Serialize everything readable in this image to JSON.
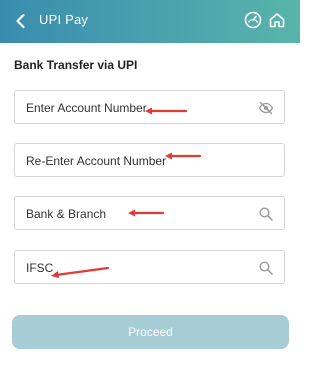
{
  "header": {
    "title": "UPI Pay",
    "back_icon": "chevron-left-icon",
    "speed_icon": "speedometer-icon",
    "home_icon": "home-icon"
  },
  "form": {
    "section_title": "Bank Transfer via UPI",
    "fields": [
      {
        "label": "Enter Account Number",
        "trailing_icon": "eye-off-icon"
      },
      {
        "label": "Re-Enter Account Number",
        "trailing_icon": ""
      },
      {
        "label": "Bank & Branch",
        "trailing_icon": "search-icon"
      },
      {
        "label": "IFSC",
        "trailing_icon": "search-icon"
      }
    ],
    "proceed_label": "Proceed"
  },
  "colors": {
    "header_start": "#3a8caf",
    "header_end": "#58b5aa",
    "annotation_arrow": "#e53935",
    "proceed_disabled": "#a6ccd6"
  }
}
